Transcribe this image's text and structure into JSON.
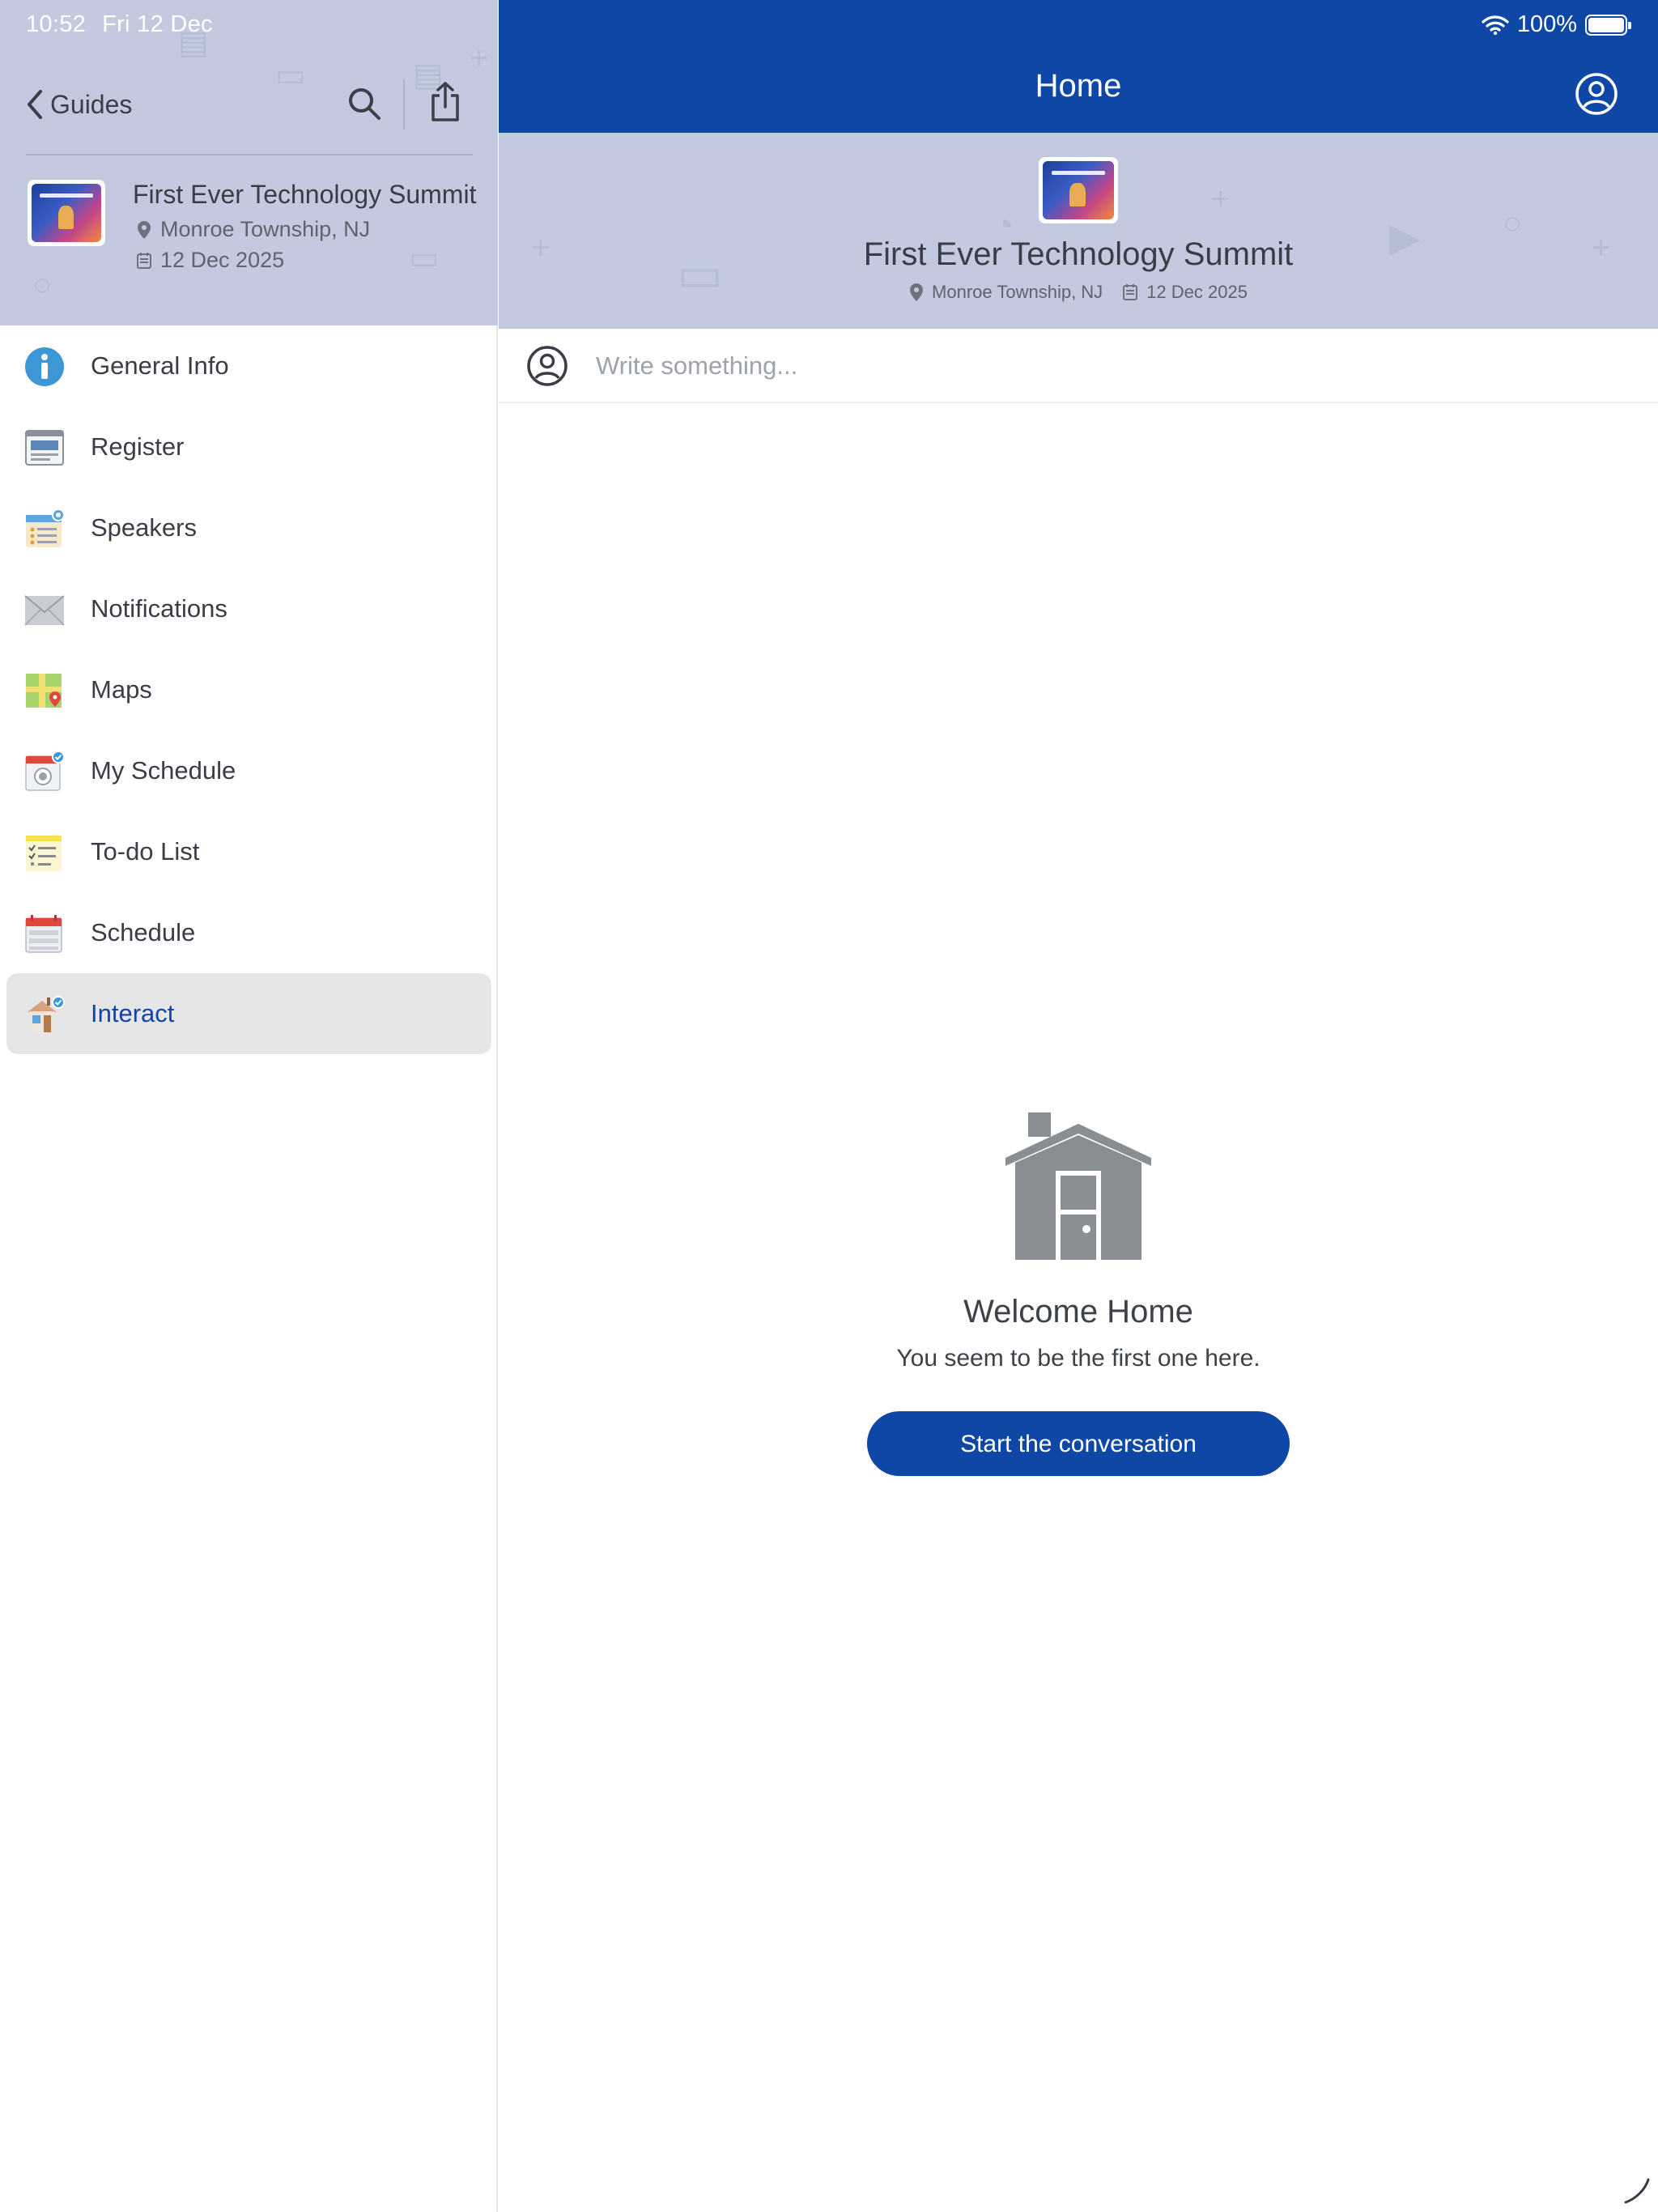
{
  "status_bar": {
    "time": "10:52",
    "date": "Fri 12 Dec",
    "battery": "100%"
  },
  "sidebar": {
    "back_label": "Guides",
    "event": {
      "title": "First Ever Technology Summit",
      "location": "Monroe Township, NJ",
      "date": "12 Dec 2025"
    },
    "items": [
      {
        "label": "General Info",
        "icon": "info-icon"
      },
      {
        "label": "Register",
        "icon": "register-icon"
      },
      {
        "label": "Speakers",
        "icon": "speakers-icon"
      },
      {
        "label": "Notifications",
        "icon": "envelope-icon"
      },
      {
        "label": "Maps",
        "icon": "map-icon"
      },
      {
        "label": "My Schedule",
        "icon": "my-schedule-icon"
      },
      {
        "label": "To-do List",
        "icon": "todo-list-icon"
      },
      {
        "label": "Schedule",
        "icon": "calendar-icon"
      },
      {
        "label": "Interact",
        "icon": "interact-icon",
        "active": true
      }
    ]
  },
  "main": {
    "title": "Home",
    "event": {
      "title": "First Ever Technology Summit",
      "location": "Monroe Township, NJ",
      "date": "12 Dec 2025"
    },
    "composer_placeholder": "Write something...",
    "empty_state": {
      "title": "Welcome Home",
      "subtitle": "You seem to be the first one here.",
      "button_label": "Start the conversation"
    }
  },
  "colors": {
    "brand_blue": "#0f47a6",
    "header_bg": "#c3cadf",
    "active_item_bg": "#e6e6e8",
    "icon_gray": "#8a8d92"
  }
}
